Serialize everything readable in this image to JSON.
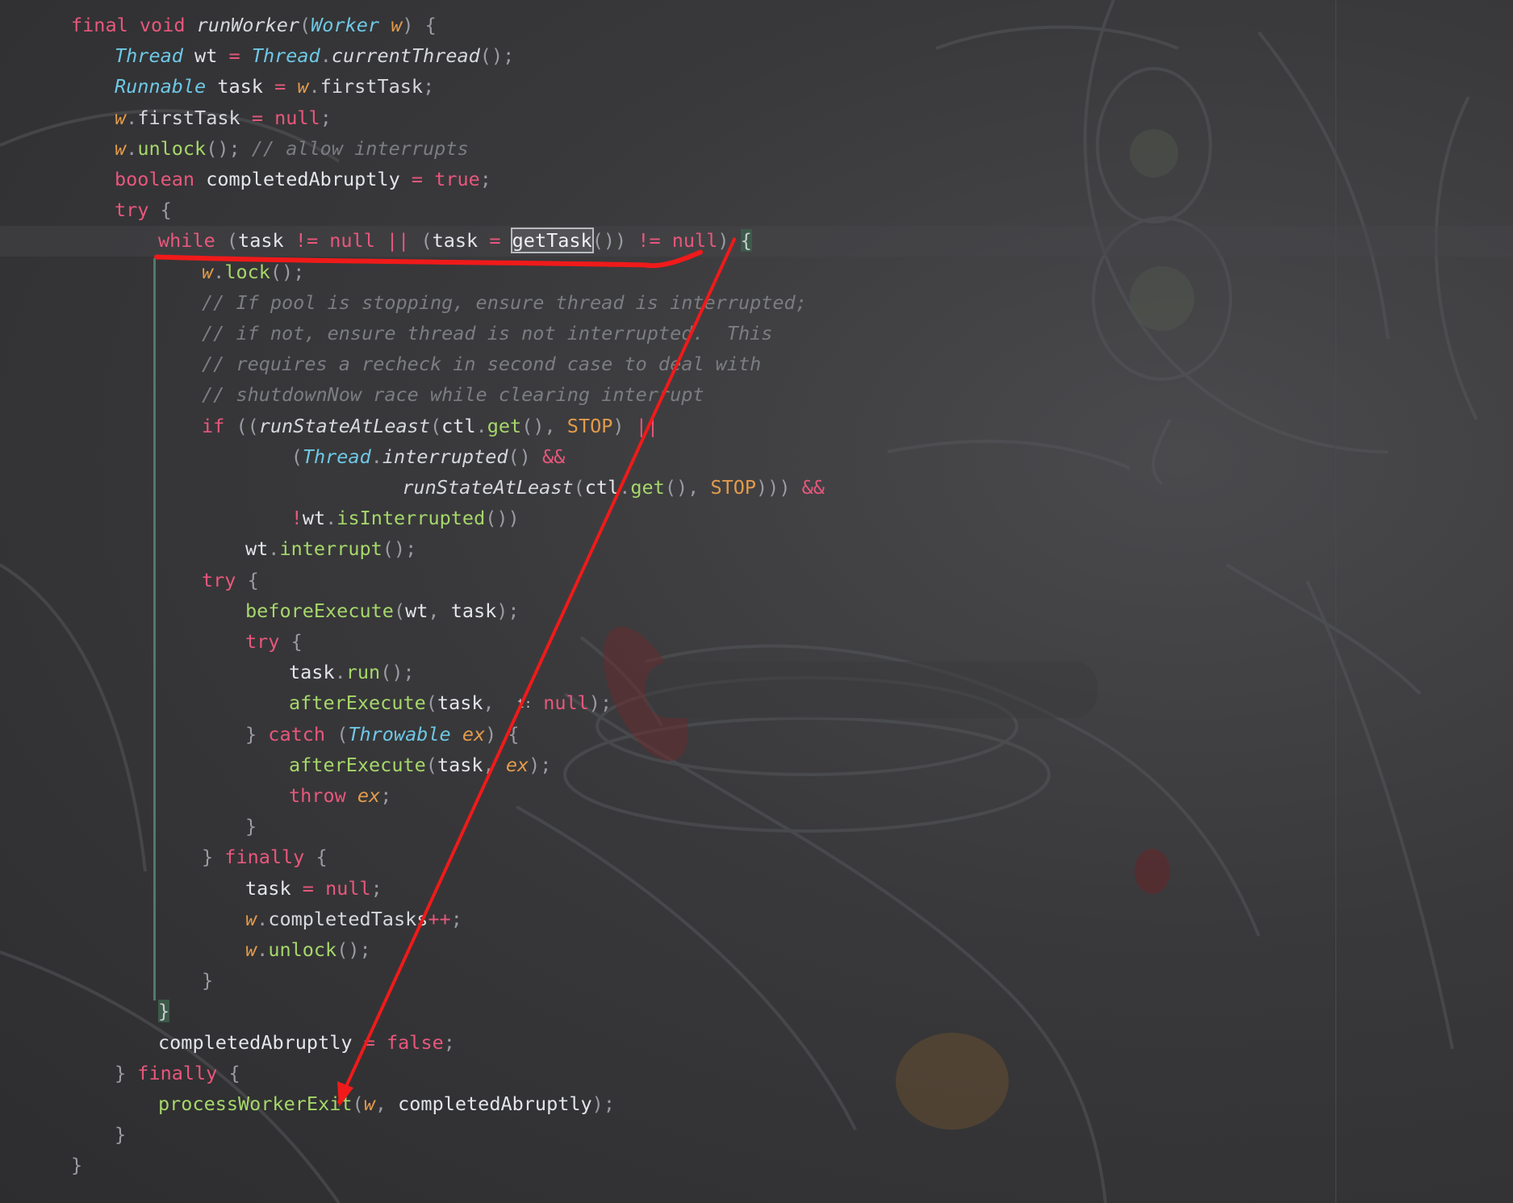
{
  "editor": {
    "lines": [
      {
        "indent": 0,
        "tokens": [
          [
            "kw",
            "final"
          ],
          [
            "pun",
            " "
          ],
          [
            "kw",
            "void"
          ],
          [
            "pun",
            " "
          ],
          [
            "fn-i",
            "runWorker"
          ],
          [
            "pun",
            "("
          ],
          [
            "ty",
            "Worker"
          ],
          [
            "pun",
            " "
          ],
          [
            "param",
            "w"
          ],
          [
            "pun",
            ") {"
          ]
        ]
      },
      {
        "indent": 1,
        "tokens": [
          [
            "ty",
            "Thread"
          ],
          [
            "pun",
            " "
          ],
          [
            "var",
            "wt"
          ],
          [
            "pun",
            " "
          ],
          [
            "op",
            "="
          ],
          [
            "pun",
            " "
          ],
          [
            "ty",
            "Thread"
          ],
          [
            "pun",
            "."
          ],
          [
            "fn-i",
            "currentThread"
          ],
          [
            "pun",
            "();"
          ]
        ]
      },
      {
        "indent": 1,
        "tokens": [
          [
            "ty",
            "Runnable"
          ],
          [
            "pun",
            " "
          ],
          [
            "var",
            "task"
          ],
          [
            "pun",
            " "
          ],
          [
            "op",
            "="
          ],
          [
            "pun",
            " "
          ],
          [
            "param",
            "w"
          ],
          [
            "pun",
            "."
          ],
          [
            "field",
            "firstTask"
          ],
          [
            "pun",
            ";"
          ]
        ]
      },
      {
        "indent": 1,
        "tokens": [
          [
            "param",
            "w"
          ],
          [
            "pun",
            "."
          ],
          [
            "field",
            "firstTask"
          ],
          [
            "pun",
            " "
          ],
          [
            "op",
            "="
          ],
          [
            "pun",
            " "
          ],
          [
            "kw",
            "null"
          ],
          [
            "pun",
            ";"
          ]
        ]
      },
      {
        "indent": 1,
        "tokens": [
          [
            "param",
            "w"
          ],
          [
            "pun",
            "."
          ],
          [
            "fn",
            "unlock"
          ],
          [
            "pun",
            "(); "
          ],
          [
            "cmt",
            "// allow interrupts"
          ]
        ]
      },
      {
        "indent": 1,
        "tokens": [
          [
            "kw",
            "boolean"
          ],
          [
            "pun",
            " "
          ],
          [
            "var",
            "completedAbruptly"
          ],
          [
            "pun",
            " "
          ],
          [
            "op",
            "="
          ],
          [
            "pun",
            " "
          ],
          [
            "kw",
            "true"
          ],
          [
            "pun",
            ";"
          ]
        ]
      },
      {
        "indent": 1,
        "tokens": [
          [
            "kw",
            "try"
          ],
          [
            "pun",
            " {"
          ]
        ]
      },
      {
        "indent": 2,
        "tokens": [
          [
            "kw",
            "while"
          ],
          [
            "pun",
            " ("
          ],
          [
            "var",
            "task"
          ],
          [
            "pun",
            " "
          ],
          [
            "op",
            "!="
          ],
          [
            "pun",
            " "
          ],
          [
            "kw",
            "null"
          ],
          [
            "pun",
            " "
          ],
          [
            "op",
            "||"
          ],
          [
            "pun",
            " ("
          ],
          [
            "var",
            "task"
          ],
          [
            "pun",
            " "
          ],
          [
            "op",
            "="
          ],
          [
            "pun",
            " "
          ],
          [
            "gettask-box",
            "getTask"
          ],
          [
            "pun",
            "()) "
          ],
          [
            "op",
            "!="
          ],
          [
            "pun",
            " "
          ],
          [
            "kw",
            "null"
          ],
          [
            "pun",
            ") "
          ],
          [
            "brace-match",
            "{"
          ]
        ]
      },
      {
        "indent": 3,
        "tokens": [
          [
            "param",
            "w"
          ],
          [
            "pun",
            "."
          ],
          [
            "fn",
            "lock"
          ],
          [
            "pun",
            "();"
          ]
        ]
      },
      {
        "indent": 3,
        "tokens": [
          [
            "cmt",
            "// If pool is stopping, ensure thread is interrupted;"
          ]
        ]
      },
      {
        "indent": 3,
        "tokens": [
          [
            "cmt",
            "// if not, ensure thread is not interrupted.  This"
          ]
        ]
      },
      {
        "indent": 3,
        "tokens": [
          [
            "cmt",
            "// requires a recheck in second case to deal with"
          ]
        ]
      },
      {
        "indent": 3,
        "tokens": [
          [
            "cmt",
            "// shutdownNow race while clearing interrupt"
          ]
        ]
      },
      {
        "indent": 3,
        "tokens": [
          [
            "kw",
            "if"
          ],
          [
            "pun",
            " (("
          ],
          [
            "fn-i",
            "runStateAtLeast"
          ],
          [
            "pun",
            "("
          ],
          [
            "var",
            "ctl"
          ],
          [
            "pun",
            "."
          ],
          [
            "fn",
            "get"
          ],
          [
            "pun",
            "(), "
          ],
          [
            "const",
            "STOP"
          ],
          [
            "pun",
            ") "
          ],
          [
            "op",
            "||"
          ]
        ]
      },
      {
        "indent": 5.05,
        "tokens": [
          [
            "pun",
            "("
          ],
          [
            "ty",
            "Thread"
          ],
          [
            "pun",
            "."
          ],
          [
            "fn-i",
            "interrupted"
          ],
          [
            "pun",
            "() "
          ],
          [
            "op",
            "&&"
          ]
        ]
      },
      {
        "indent": 7.6,
        "tokens": [
          [
            "fn-i",
            "runStateAtLeast"
          ],
          [
            "pun",
            "("
          ],
          [
            "var",
            "ctl"
          ],
          [
            "pun",
            "."
          ],
          [
            "fn",
            "get"
          ],
          [
            "pun",
            "(), "
          ],
          [
            "const",
            "STOP"
          ],
          [
            "pun",
            ")))"
          ],
          [
            "pun",
            " "
          ],
          [
            "op",
            "&&"
          ]
        ]
      },
      {
        "indent": 5.05,
        "tokens": [
          [
            "op",
            "!"
          ],
          [
            "var",
            "wt"
          ],
          [
            "pun",
            "."
          ],
          [
            "fn",
            "isInterrupted"
          ],
          [
            "pun",
            "())"
          ]
        ]
      },
      {
        "indent": 4,
        "tokens": [
          [
            "var",
            "wt"
          ],
          [
            "pun",
            "."
          ],
          [
            "fn",
            "interrupt"
          ],
          [
            "pun",
            "();"
          ]
        ]
      },
      {
        "indent": 3,
        "tokens": [
          [
            "kw",
            "try"
          ],
          [
            "pun",
            " {"
          ]
        ]
      },
      {
        "indent": 4,
        "tokens": [
          [
            "fn",
            "beforeExecute"
          ],
          [
            "pun",
            "("
          ],
          [
            "var",
            "wt"
          ],
          [
            "pun",
            ", "
          ],
          [
            "var",
            "task"
          ],
          [
            "pun",
            ");"
          ]
        ]
      },
      {
        "indent": 4,
        "tokens": [
          [
            "kw",
            "try"
          ],
          [
            "pun",
            " {"
          ]
        ]
      },
      {
        "indent": 5,
        "tokens": [
          [
            "var",
            "task"
          ],
          [
            "pun",
            "."
          ],
          [
            "fn",
            "run"
          ],
          [
            "pun",
            "();"
          ]
        ]
      },
      {
        "indent": 5,
        "tokens": [
          [
            "fn",
            "afterExecute"
          ],
          [
            "pun",
            "("
          ],
          [
            "var",
            "task"
          ],
          [
            "pun",
            ",  "
          ],
          [
            "hint",
            "t:"
          ],
          [
            "pun",
            " "
          ],
          [
            "kw",
            "null"
          ],
          [
            "pun",
            ");"
          ]
        ]
      },
      {
        "indent": 4,
        "tokens": [
          [
            "pun",
            "} "
          ],
          [
            "kw",
            "catch"
          ],
          [
            "pun",
            " ("
          ],
          [
            "ty",
            "Throwable"
          ],
          [
            "pun",
            " "
          ],
          [
            "param",
            "ex"
          ],
          [
            "pun",
            ") {"
          ]
        ]
      },
      {
        "indent": 5,
        "tokens": [
          [
            "fn",
            "afterExecute"
          ],
          [
            "pun",
            "("
          ],
          [
            "var",
            "task"
          ],
          [
            "pun",
            ", "
          ],
          [
            "param",
            "ex"
          ],
          [
            "pun",
            ");"
          ]
        ]
      },
      {
        "indent": 5,
        "tokens": [
          [
            "kw",
            "throw"
          ],
          [
            "pun",
            " "
          ],
          [
            "param",
            "ex"
          ],
          [
            "pun",
            ";"
          ]
        ]
      },
      {
        "indent": 4,
        "tokens": [
          [
            "pun",
            "}"
          ]
        ]
      },
      {
        "indent": 3,
        "tokens": [
          [
            "pun",
            "} "
          ],
          [
            "kw",
            "finally"
          ],
          [
            "pun",
            " {"
          ]
        ]
      },
      {
        "indent": 4,
        "tokens": [
          [
            "var",
            "task"
          ],
          [
            "pun",
            " "
          ],
          [
            "op",
            "="
          ],
          [
            "pun",
            " "
          ],
          [
            "kw",
            "null"
          ],
          [
            "pun",
            ";"
          ]
        ]
      },
      {
        "indent": 4,
        "tokens": [
          [
            "param",
            "w"
          ],
          [
            "pun",
            "."
          ],
          [
            "field",
            "completedTasks"
          ],
          [
            "op",
            "++"
          ],
          [
            "pun",
            ";"
          ]
        ]
      },
      {
        "indent": 4,
        "tokens": [
          [
            "param",
            "w"
          ],
          [
            "pun",
            "."
          ],
          [
            "fn",
            "unlock"
          ],
          [
            "pun",
            "();"
          ]
        ]
      },
      {
        "indent": 3,
        "tokens": [
          [
            "pun",
            "}"
          ]
        ]
      },
      {
        "indent": 2,
        "tokens": [
          [
            "brace-match",
            "}"
          ]
        ]
      },
      {
        "indent": 2,
        "tokens": [
          [
            "var",
            "completedAbruptly"
          ],
          [
            "pun",
            " "
          ],
          [
            "op",
            "="
          ],
          [
            "pun",
            " "
          ],
          [
            "kw",
            "false"
          ],
          [
            "pun",
            ";"
          ]
        ]
      },
      {
        "indent": 1,
        "tokens": [
          [
            "pun",
            "} "
          ],
          [
            "kw",
            "finally"
          ],
          [
            "pun",
            " {"
          ]
        ]
      },
      {
        "indent": 2,
        "tokens": [
          [
            "fn",
            "processWorkerExit"
          ],
          [
            "pun",
            "("
          ],
          [
            "param",
            "w"
          ],
          [
            "pun",
            ", "
          ],
          [
            "var",
            "completedAbruptly"
          ],
          [
            "pun",
            ");"
          ]
        ]
      },
      {
        "indent": 1,
        "tokens": [
          [
            "pun",
            "}"
          ]
        ]
      },
      {
        "indent": 0,
        "tokens": [
          [
            "pun",
            "}"
          ]
        ]
      }
    ]
  },
  "annotations": {
    "color": "#f01a1a",
    "underline_line_index": 7,
    "arrow_from_line_index": 7,
    "arrow_to_line_index": 35
  }
}
